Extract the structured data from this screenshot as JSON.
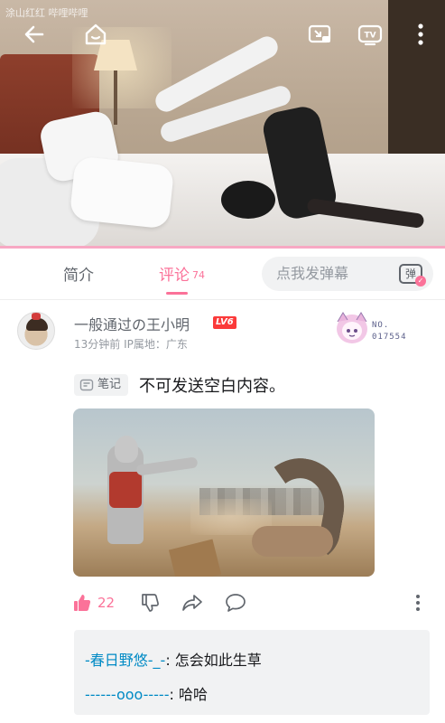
{
  "video": {
    "watermark": "涂山红红 哔哩哔哩",
    "icons": [
      "back-arrow-icon",
      "home-icon",
      "screen-cast-icon",
      "tv-icon",
      "more-vertical-icon"
    ]
  },
  "tabs": {
    "intro_label": "简介",
    "comments_label": "评论",
    "comments_count": "74",
    "danmaku_placeholder": "点我发弹幕",
    "danmaku_toggle_label": "弹"
  },
  "comment": {
    "username": "一般通过の王小明",
    "level": "LV6",
    "time": "13分钟前",
    "ip_location": "IP属地：广东",
    "fan_badge_label": "NO.",
    "fan_badge_number": "017554",
    "note_tag": "笔记",
    "text": "不可发送空白内容。",
    "likes": "22"
  },
  "replies": [
    {
      "name": "-春日野悠-_-",
      "text": ": 怎会如此生草"
    },
    {
      "name": "------ooo-----",
      "text": ": 哈哈"
    }
  ],
  "colors": {
    "accent": "#fb7299",
    "reply_name": "#008ac5",
    "level_badge": "#fb3a3a"
  }
}
